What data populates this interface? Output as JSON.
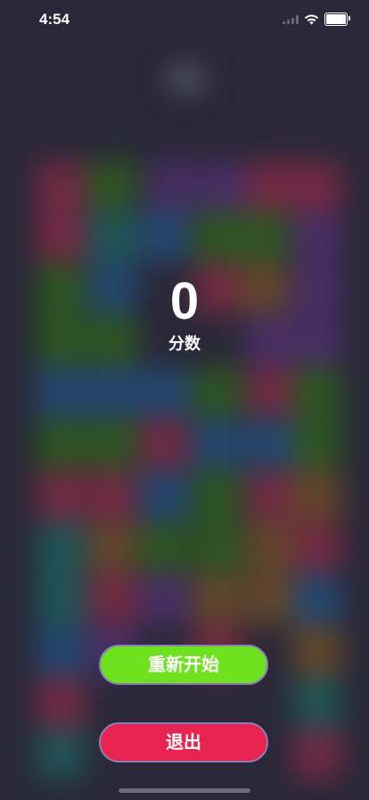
{
  "status_bar": {
    "time": "4:54"
  },
  "score": {
    "value": "0",
    "label": "分数"
  },
  "buttons": {
    "restart_label": "重新开始",
    "exit_label": "退出"
  },
  "colors": {
    "restart_button": "#6ee21e",
    "exit_button": "#e8234f",
    "background": "#2a2838"
  }
}
